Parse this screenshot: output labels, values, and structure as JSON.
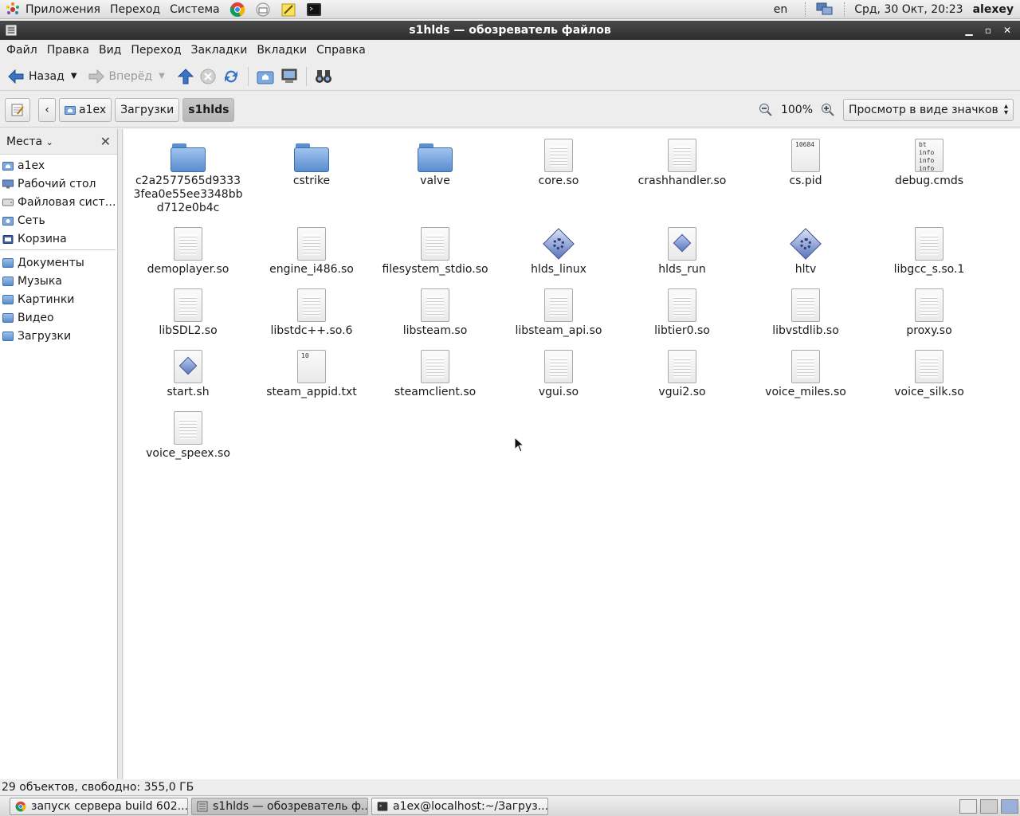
{
  "top_panel": {
    "menu_apps": "Приложения",
    "menu_go": "Переход",
    "menu_system": "Система",
    "launchers": [
      "chrome-icon",
      "mail-icon",
      "notes-icon",
      "terminal-icon"
    ],
    "keyboard_layout": "en",
    "datetime": "Срд, 30 Окт, 20:23",
    "username": "alexey"
  },
  "window": {
    "title": "s1hlds — обозреватель файлов"
  },
  "menubar": {
    "items": [
      "Файл",
      "Правка",
      "Вид",
      "Переход",
      "Закладки",
      "Вкладки",
      "Справка"
    ]
  },
  "toolbar": {
    "back_label": "Назад",
    "forward_label": "Вперёд"
  },
  "location": {
    "crumbs": [
      "a1ex",
      "Загрузки",
      "s1hlds"
    ],
    "zoom_label": "100%",
    "view_mode": "Просмотр в виде значков"
  },
  "sidebar": {
    "title": "Места",
    "places": [
      "a1ex",
      "Рабочий стол",
      "Файловая сист…",
      "Сеть",
      "Корзина"
    ],
    "bookmarks": [
      "Документы",
      "Музыка",
      "Картинки",
      "Видео",
      "Загрузки"
    ]
  },
  "files": [
    {
      "name": "c2a2577565d93333fea0e55ee3348bbd712e0b4c",
      "kind": "folder"
    },
    {
      "name": "cstrike",
      "kind": "folder"
    },
    {
      "name": "valve",
      "kind": "folder"
    },
    {
      "name": "core.so",
      "kind": "file"
    },
    {
      "name": "crashhandler.so",
      "kind": "file"
    },
    {
      "name": "cs.pid",
      "kind": "text",
      "preview": "10684"
    },
    {
      "name": "debug.cmds",
      "kind": "text",
      "preview": "bt\ninfo\ninfo\ninfo"
    },
    {
      "name": "demoplayer.so",
      "kind": "file"
    },
    {
      "name": "engine_i486.so",
      "kind": "file"
    },
    {
      "name": "filesystem_stdio.so",
      "kind": "file"
    },
    {
      "name": "hlds_linux",
      "kind": "exec"
    },
    {
      "name": "hlds_run",
      "kind": "script"
    },
    {
      "name": "hltv",
      "kind": "exec"
    },
    {
      "name": "libgcc_s.so.1",
      "kind": "file"
    },
    {
      "name": "libSDL2.so",
      "kind": "file"
    },
    {
      "name": "libstdc++.so.6",
      "kind": "file"
    },
    {
      "name": "libsteam.so",
      "kind": "file"
    },
    {
      "name": "libsteam_api.so",
      "kind": "file"
    },
    {
      "name": "libtier0.so",
      "kind": "file"
    },
    {
      "name": "libvstdlib.so",
      "kind": "file"
    },
    {
      "name": "proxy.so",
      "kind": "file"
    },
    {
      "name": "start.sh",
      "kind": "script"
    },
    {
      "name": "steam_appid.txt",
      "kind": "text",
      "preview": "10"
    },
    {
      "name": "steamclient.so",
      "kind": "file"
    },
    {
      "name": "vgui.so",
      "kind": "file"
    },
    {
      "name": "vgui2.so",
      "kind": "file"
    },
    {
      "name": "voice_miles.so",
      "kind": "file"
    },
    {
      "name": "voice_silk.so",
      "kind": "file"
    },
    {
      "name": "voice_speex.so",
      "kind": "file"
    }
  ],
  "status": {
    "text": "29 объектов, свободно: 355,0 ГБ"
  },
  "taskbar": {
    "tasks": [
      {
        "label": "запуск сервера build 602...",
        "icon": "chrome-icon"
      },
      {
        "label": "s1hlds — обозреватель ф...",
        "icon": "file-manager-icon"
      },
      {
        "label": "a1ex@localhost:~/Загруз...",
        "icon": "terminal-icon"
      }
    ]
  }
}
